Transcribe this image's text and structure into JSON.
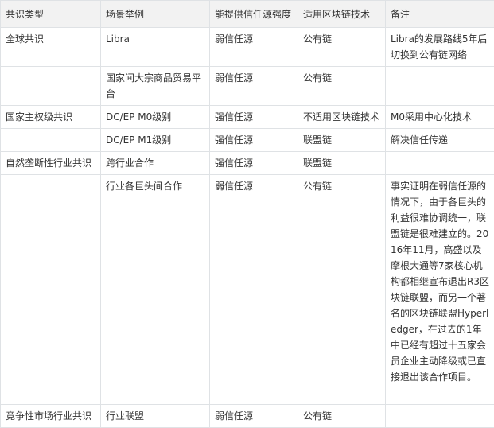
{
  "table": {
    "headers": [
      "共识类型",
      "场景举例",
      "能提供信任源强度",
      "适用区块链技术",
      "备注"
    ],
    "rows": [
      {
        "type": "全球共识",
        "scene": "Libra",
        "strength": "弱信任源",
        "tech": "公有链",
        "note": "Libra的发展路线5年后切换到公有链网络"
      },
      {
        "type": "",
        "scene": "国家间大宗商品贸易平台",
        "strength": "弱信任源",
        "tech": "公有链",
        "note": ""
      },
      {
        "type": "国家主权级共识",
        "scene": "DC/EP M0级别",
        "strength": "强信任源",
        "tech": "不适用区块链技术",
        "note": "M0采用中心化技术"
      },
      {
        "type": "",
        "scene": "DC/EP M1级别",
        "strength": "强信任源",
        "tech": "联盟链",
        "note": "解决信任传递"
      },
      {
        "type": "自然垄断性行业共识",
        "scene": "跨行业合作",
        "strength": "强信任源",
        "tech": "联盟链",
        "note": ""
      },
      {
        "type": "",
        "scene": "行业各巨头间合作",
        "strength": "弱信任源",
        "tech": "公有链",
        "note": "事实证明在弱信任源的情况下，由于各巨头的利益很难协调统一，联盟链是很难建立的。2016年11月，高盛以及摩根大通等7家核心机构都相继宣布退出R3区块链联盟，而另一个著名的区块链联盟Hyperledger，在过去的1年中已经有超过十五家会员企业主动降级或已直接退出该合作项目。"
      },
      {
        "type": "竞争性市场行业共识",
        "scene": "行业联盟",
        "strength": "弱信任源",
        "tech": "公有链",
        "note": ""
      }
    ]
  }
}
